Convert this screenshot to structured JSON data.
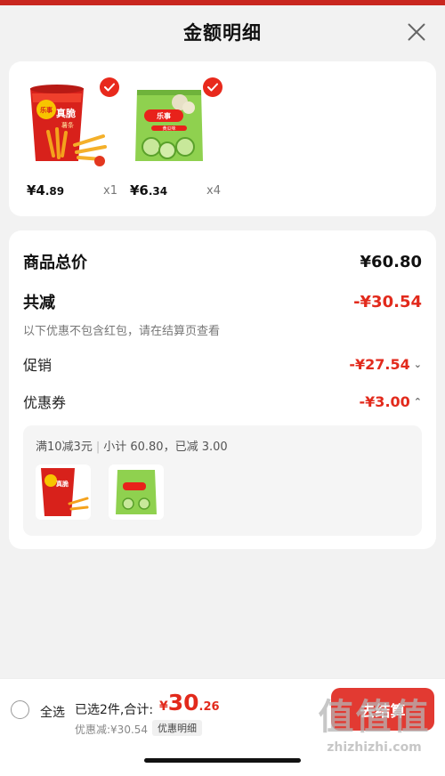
{
  "header": {
    "title": "金额明细"
  },
  "products": [
    {
      "name": "乐事真脆薯条",
      "price_int": "¥4",
      "price_dec": ".89",
      "qty": "x1",
      "brand_text": "乐事",
      "flavor_text": "真脆",
      "sub_text": "薯条"
    },
    {
      "name": "乐事黄瓜味薯片",
      "price_int": "¥6",
      "price_dec": ".34",
      "qty": "x4",
      "brand_text": "乐事",
      "flavor_text": "黄瓜味"
    }
  ],
  "summary": {
    "goods_total_label": "商品总价",
    "goods_total_value": "¥60.80",
    "total_reduce_label": "共减",
    "total_reduce_value": "-¥30.54",
    "note": "以下优惠不包含红包，请在结算页查看",
    "promo_label": "促销",
    "promo_value": "-¥27.54",
    "coupon_label": "优惠券",
    "coupon_value": "-¥3.00",
    "coupon_rule": "满10减3元",
    "coupon_subtotal": "小计 60.80，已减 3.00"
  },
  "bottom": {
    "select_all": "全选",
    "selected_text": "已选2件,合计:",
    "total_currency": "¥",
    "total_int": "30",
    "total_dec": ".26",
    "discount_text": "优惠减:¥30.54",
    "detail_tag": "优惠明细",
    "checkout": "去结算"
  },
  "watermark": {
    "big": "值值值",
    "small": "zhizhizhi.com"
  },
  "colors": {
    "accent": "#e22a1c",
    "checkout": "#e23a32"
  }
}
